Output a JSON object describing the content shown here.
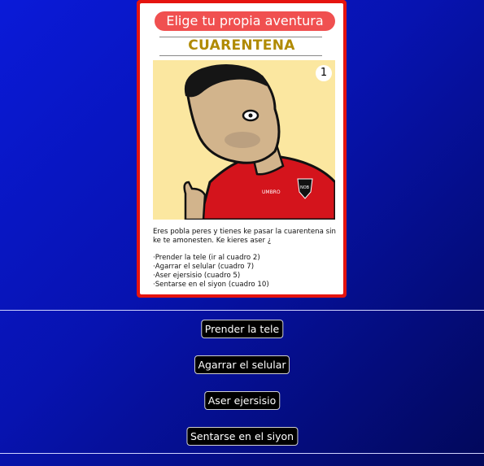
{
  "card": {
    "banner": "Elige tu propia aventura",
    "title": "CUARENTENA",
    "panel_number": "1",
    "intro": "Eres pobla peres y tienes ke pasar la cuarentena sin ke te amonesten. Ke kieres aser ¿",
    "options": [
      "·Prender la tele (ir al cuadro 2)",
      "·Agarrar el selular (cuadro 7)",
      "·Aser ejersisio (cuadro 5)",
      "·Sentarse en el siyon (cuadro 10)"
    ],
    "shirt_text": "UMBRO",
    "crest_text": "NOB"
  },
  "choices": [
    "Prender la tele",
    "Agarrar el selular",
    "Aser ejersisio",
    "Sentarse en el siyon"
  ],
  "colors": {
    "card_border": "#e5140f",
    "banner": "#f05050",
    "title": "#b08a00",
    "panel_bg": "#fbe7a0",
    "shirt": "#d4141c"
  }
}
